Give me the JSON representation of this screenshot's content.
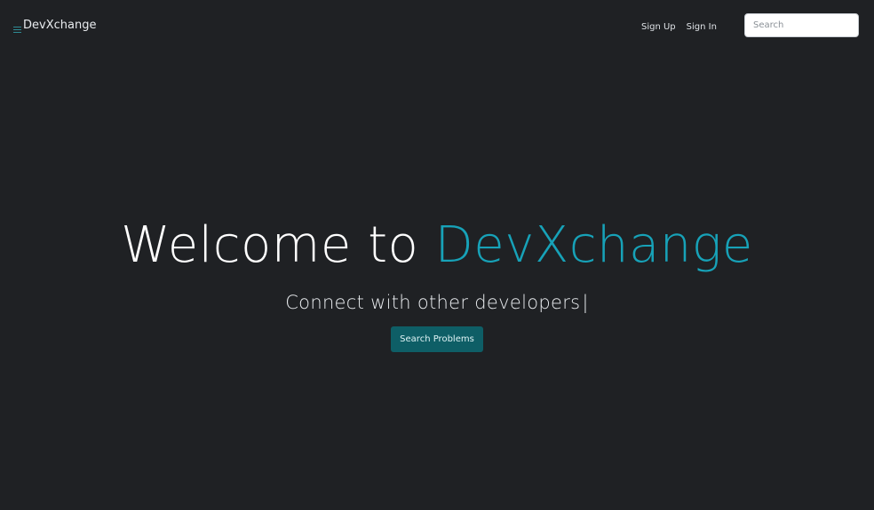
{
  "navbar": {
    "brand": "DevXchange",
    "links": [
      "Sign Up",
      "Sign In"
    ],
    "search_placeholder": "Search"
  },
  "hero": {
    "title_prefix": "Welcome to",
    "title_accent": "DevXchange",
    "subtitle": "Connect with other developers",
    "cursor": "|",
    "button_label": "Search Problems"
  },
  "colors": {
    "background": "#1f2124",
    "accent": "#17a2b8",
    "button": "#0e5e66"
  }
}
